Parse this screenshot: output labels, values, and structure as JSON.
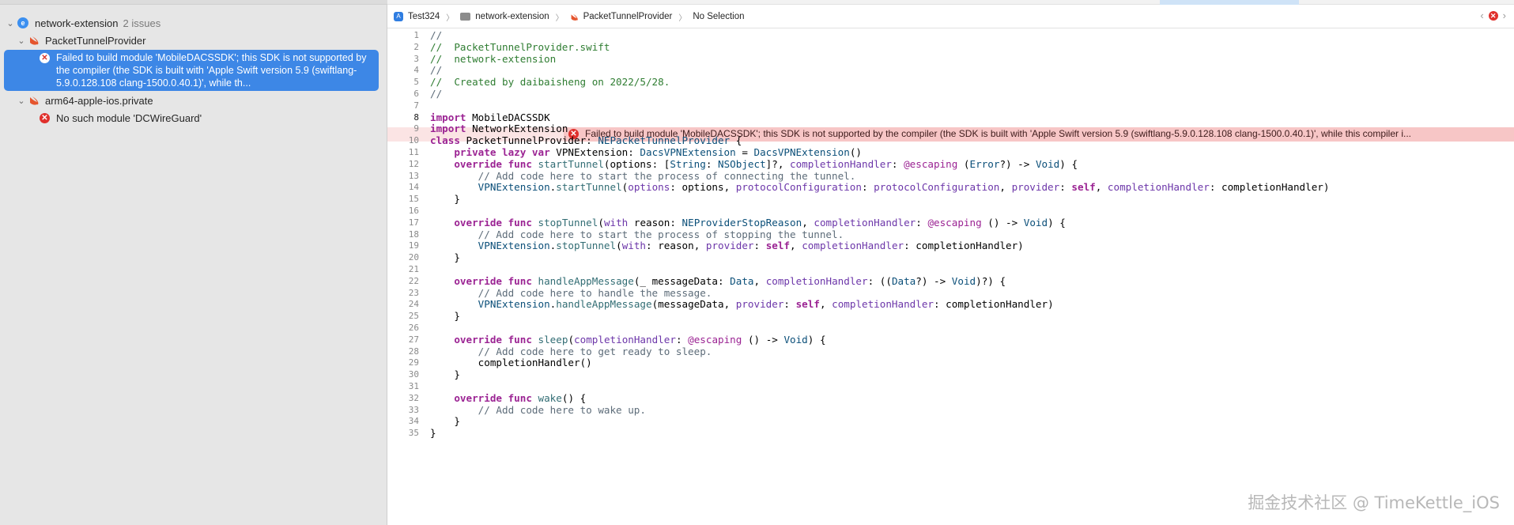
{
  "navigator": {
    "project": {
      "name": "network-extension",
      "issues": "2 issues"
    },
    "groups": [
      {
        "name": "PacketTunnelProvider",
        "issue": "Failed to build module 'MobileDACSSDK'; this SDK is not supported by the compiler (the SDK is built with 'Apple Swift version 5.9 (swiftlang-5.9.0.128.108 clang-1500.0.40.1)', while th..."
      },
      {
        "name": "arm64-apple-ios.private",
        "issue": "No such module 'DCWireGuard'"
      }
    ]
  },
  "jumpbar": {
    "crumbs": [
      "Test324",
      "network-extension",
      "PacketTunnelProvider",
      "No Selection"
    ]
  },
  "editor": {
    "line_numbers": [
      "1",
      "2",
      "3",
      "4",
      "5",
      "6",
      "7",
      "8",
      "9",
      "10",
      "11",
      "12",
      "13",
      "14",
      "15",
      "16",
      "17",
      "18",
      "19",
      "20",
      "21",
      "22",
      "23",
      "24",
      "25",
      "26",
      "27",
      "28",
      "29",
      "30",
      "31",
      "32",
      "33",
      "34",
      "35"
    ],
    "current_line": "8",
    "inline_error": "Failed to build module 'MobileDACSSDK'; this SDK is not supported by the compiler (the SDK is built with 'Apple Swift version 5.9 (swiftlang-5.9.0.128.108 clang-1500.0.40.1)', while this compiler i...",
    "lines": [
      [
        [
          "cmt",
          "//"
        ]
      ],
      [
        [
          "cmtg",
          "//  PacketTunnelProvider.swift"
        ]
      ],
      [
        [
          "cmtg",
          "//  network-extension"
        ]
      ],
      [
        [
          "cmt",
          "//"
        ]
      ],
      [
        [
          "cmtg",
          "//  Created by daibaisheng on 2022/5/28."
        ]
      ],
      [
        [
          "cmt",
          "//"
        ]
      ],
      [],
      [
        [
          "kw",
          "import"
        ],
        [
          "p",
          " MobileDACSSDK"
        ]
      ],
      [
        [
          "kw",
          "import"
        ],
        [
          "p",
          " NetworkExtension"
        ]
      ],
      [
        [
          "kw",
          "class"
        ],
        [
          "p",
          " PacketTunnelProvider: "
        ],
        [
          "ty",
          "NEPacketTunnelProvider"
        ],
        [
          "p",
          " {"
        ]
      ],
      [
        [
          "p",
          "    "
        ],
        [
          "kw",
          "private lazy var"
        ],
        [
          "p",
          " VPNExtension: "
        ],
        [
          "ty",
          "DacsVPNExtension"
        ],
        [
          "p",
          " = "
        ],
        [
          "ty",
          "DacsVPNExtension"
        ],
        [
          "p",
          "()"
        ]
      ],
      [
        [
          "p",
          "    "
        ],
        [
          "kw",
          "override func"
        ],
        [
          "p",
          " "
        ],
        [
          "fn",
          "startTunnel"
        ],
        [
          "p",
          "(options: ["
        ],
        [
          "ty",
          "String"
        ],
        [
          "p",
          ": "
        ],
        [
          "ty",
          "NSObject"
        ],
        [
          "p",
          "]?, "
        ],
        [
          "pr",
          "completionHandler"
        ],
        [
          "p",
          ": "
        ],
        [
          "at",
          "@escaping"
        ],
        [
          "p",
          " ("
        ],
        [
          "ty",
          "Error"
        ],
        [
          "p",
          "?) -> "
        ],
        [
          "ty",
          "Void"
        ],
        [
          "p",
          ") {"
        ]
      ],
      [
        [
          "p",
          "        "
        ],
        [
          "cmt",
          "// Add code here to start the process of connecting the tunnel."
        ]
      ],
      [
        [
          "p",
          "        "
        ],
        [
          "ty",
          "VPNExtension"
        ],
        [
          "p",
          "."
        ],
        [
          "fn",
          "startTunnel"
        ],
        [
          "p",
          "("
        ],
        [
          "pr",
          "options"
        ],
        [
          "p",
          ": options, "
        ],
        [
          "pr",
          "protocolConfiguration"
        ],
        [
          "p",
          ": "
        ],
        [
          "pr",
          "protocolConfiguration"
        ],
        [
          "p",
          ", "
        ],
        [
          "pr",
          "provider"
        ],
        [
          "p",
          ": "
        ],
        [
          "kw",
          "self"
        ],
        [
          "p",
          ", "
        ],
        [
          "pr",
          "completionHandler"
        ],
        [
          "p",
          ": completionHandler)"
        ]
      ],
      [
        [
          "p",
          "    }"
        ]
      ],
      [],
      [
        [
          "p",
          "    "
        ],
        [
          "kw",
          "override func"
        ],
        [
          "p",
          " "
        ],
        [
          "fn",
          "stopTunnel"
        ],
        [
          "p",
          "("
        ],
        [
          "pr",
          "with"
        ],
        [
          "p",
          " reason: "
        ],
        [
          "ty",
          "NEProviderStopReason"
        ],
        [
          "p",
          ", "
        ],
        [
          "pr",
          "completionHandler"
        ],
        [
          "p",
          ": "
        ],
        [
          "at",
          "@escaping"
        ],
        [
          "p",
          " () -> "
        ],
        [
          "ty",
          "Void"
        ],
        [
          "p",
          ") {"
        ]
      ],
      [
        [
          "p",
          "        "
        ],
        [
          "cmt",
          "// Add code here to start the process of stopping the tunnel."
        ]
      ],
      [
        [
          "p",
          "        "
        ],
        [
          "ty",
          "VPNExtension"
        ],
        [
          "p",
          "."
        ],
        [
          "fn",
          "stopTunnel"
        ],
        [
          "p",
          "("
        ],
        [
          "pr",
          "with"
        ],
        [
          "p",
          ": reason, "
        ],
        [
          "pr",
          "provider"
        ],
        [
          "p",
          ": "
        ],
        [
          "kw",
          "self"
        ],
        [
          "p",
          ", "
        ],
        [
          "pr",
          "completionHandler"
        ],
        [
          "p",
          ": completionHandler)"
        ]
      ],
      [
        [
          "p",
          "    }"
        ]
      ],
      [],
      [
        [
          "p",
          "    "
        ],
        [
          "kw",
          "override func"
        ],
        [
          "p",
          " "
        ],
        [
          "fn",
          "handleAppMessage"
        ],
        [
          "p",
          "(_ messageData: "
        ],
        [
          "ty",
          "Data"
        ],
        [
          "p",
          ", "
        ],
        [
          "pr",
          "completionHandler"
        ],
        [
          "p",
          ": (("
        ],
        [
          "ty",
          "Data"
        ],
        [
          "p",
          "?) -> "
        ],
        [
          "ty",
          "Void"
        ],
        [
          "p",
          ")?) {"
        ]
      ],
      [
        [
          "p",
          "        "
        ],
        [
          "cmt",
          "// Add code here to handle the message."
        ]
      ],
      [
        [
          "p",
          "        "
        ],
        [
          "ty",
          "VPNExtension"
        ],
        [
          "p",
          "."
        ],
        [
          "fn",
          "handleAppMessage"
        ],
        [
          "p",
          "(messageData, "
        ],
        [
          "pr",
          "provider"
        ],
        [
          "p",
          ": "
        ],
        [
          "kw",
          "self"
        ],
        [
          "p",
          ", "
        ],
        [
          "pr",
          "completionHandler"
        ],
        [
          "p",
          ": completionHandler)"
        ]
      ],
      [
        [
          "p",
          "    }"
        ]
      ],
      [],
      [
        [
          "p",
          "    "
        ],
        [
          "kw",
          "override func"
        ],
        [
          "p",
          " "
        ],
        [
          "fn",
          "sleep"
        ],
        [
          "p",
          "("
        ],
        [
          "pr",
          "completionHandler"
        ],
        [
          "p",
          ": "
        ],
        [
          "at",
          "@escaping"
        ],
        [
          "p",
          " () -> "
        ],
        [
          "ty",
          "Void"
        ],
        [
          "p",
          ") {"
        ]
      ],
      [
        [
          "p",
          "        "
        ],
        [
          "cmt",
          "// Add code here to get ready to sleep."
        ]
      ],
      [
        [
          "p",
          "        completionHandler()"
        ]
      ],
      [
        [
          "p",
          "    }"
        ]
      ],
      [],
      [
        [
          "p",
          "    "
        ],
        [
          "kw",
          "override func"
        ],
        [
          "p",
          " "
        ],
        [
          "fn",
          "wake"
        ],
        [
          "p",
          "() {"
        ]
      ],
      [
        [
          "p",
          "        "
        ],
        [
          "cmt",
          "// Add code here to wake up."
        ]
      ],
      [
        [
          "p",
          "    }"
        ]
      ],
      [
        [
          "p",
          "}"
        ]
      ]
    ]
  },
  "watermark": "掘金技术社区 @ TimeKettle_iOS"
}
